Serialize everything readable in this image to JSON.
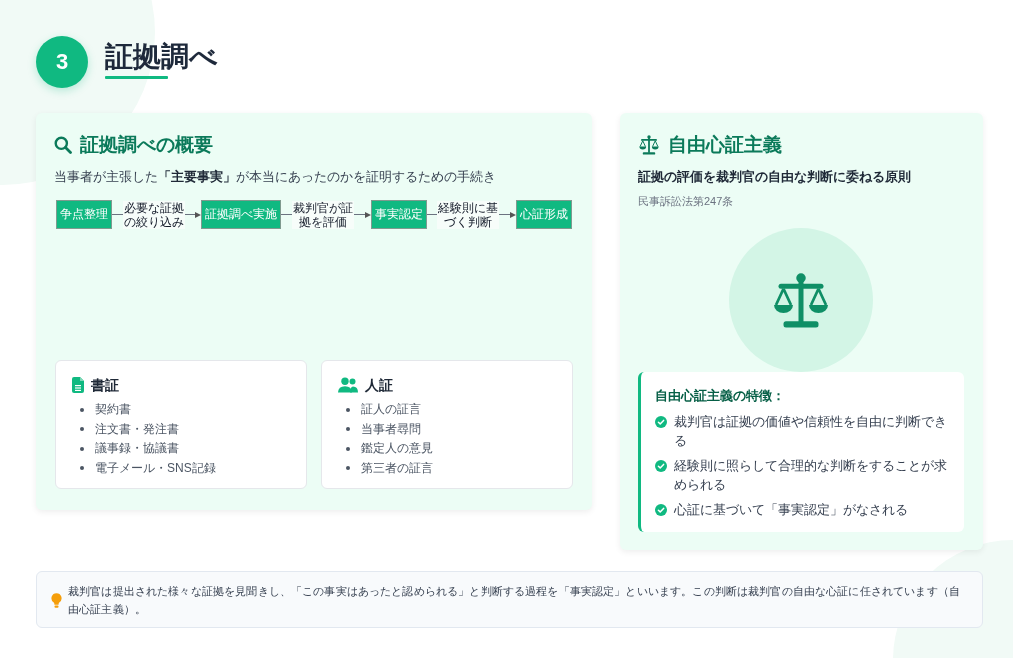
{
  "section": {
    "number": "3",
    "title": "証拠調べ"
  },
  "overview": {
    "title": "証拠調べの概要",
    "description": "当事者が主張した**「主要事実」**が本当にあったのかを証明するための手続き",
    "flow": [
      {
        "kind": "step",
        "label": "争点整理"
      },
      {
        "kind": "edge",
        "label": "必要な証拠の絞り込み"
      },
      {
        "kind": "step",
        "label": "証拠調べ実施"
      },
      {
        "kind": "edge",
        "label": "裁判官が証拠を評価"
      },
      {
        "kind": "step",
        "label": "事実認定"
      },
      {
        "kind": "edge",
        "label": "経験則に基づく判断"
      },
      {
        "kind": "step",
        "label": "心証形成"
      }
    ],
    "evidence_types": [
      {
        "kind": "document",
        "title": "書証",
        "items": [
          "契約書",
          "注文書・発注書",
          "議事録・協議書",
          "電子メール・SNS記録"
        ]
      },
      {
        "kind": "person",
        "title": "人証",
        "items": [
          "証人の証言",
          "当事者尋問",
          "鑑定人の意見",
          "第三者の証言"
        ]
      }
    ]
  },
  "principle": {
    "title": "自由心証主義",
    "summary": "証拠の評価を裁判官の自由な判断に委ねる原則",
    "reference": "民事訴訟法第247条",
    "features_title": "自由心証主義の特徴：",
    "features": [
      "裁判官は証拠の価値や信頼性を自由に判断できる",
      "経験則に照らして合理的な判断をすることが求められる",
      "心証に基づいて「事実認定」がなされる"
    ]
  },
  "note": {
    "text": "裁判官は提出された様々な証拠を見聞きし、「この事実はあったと認められる」と判断する過程を「事実認定」といいます。この判断は裁判官の自由な心証に任されています（自由心証主義）。"
  }
}
